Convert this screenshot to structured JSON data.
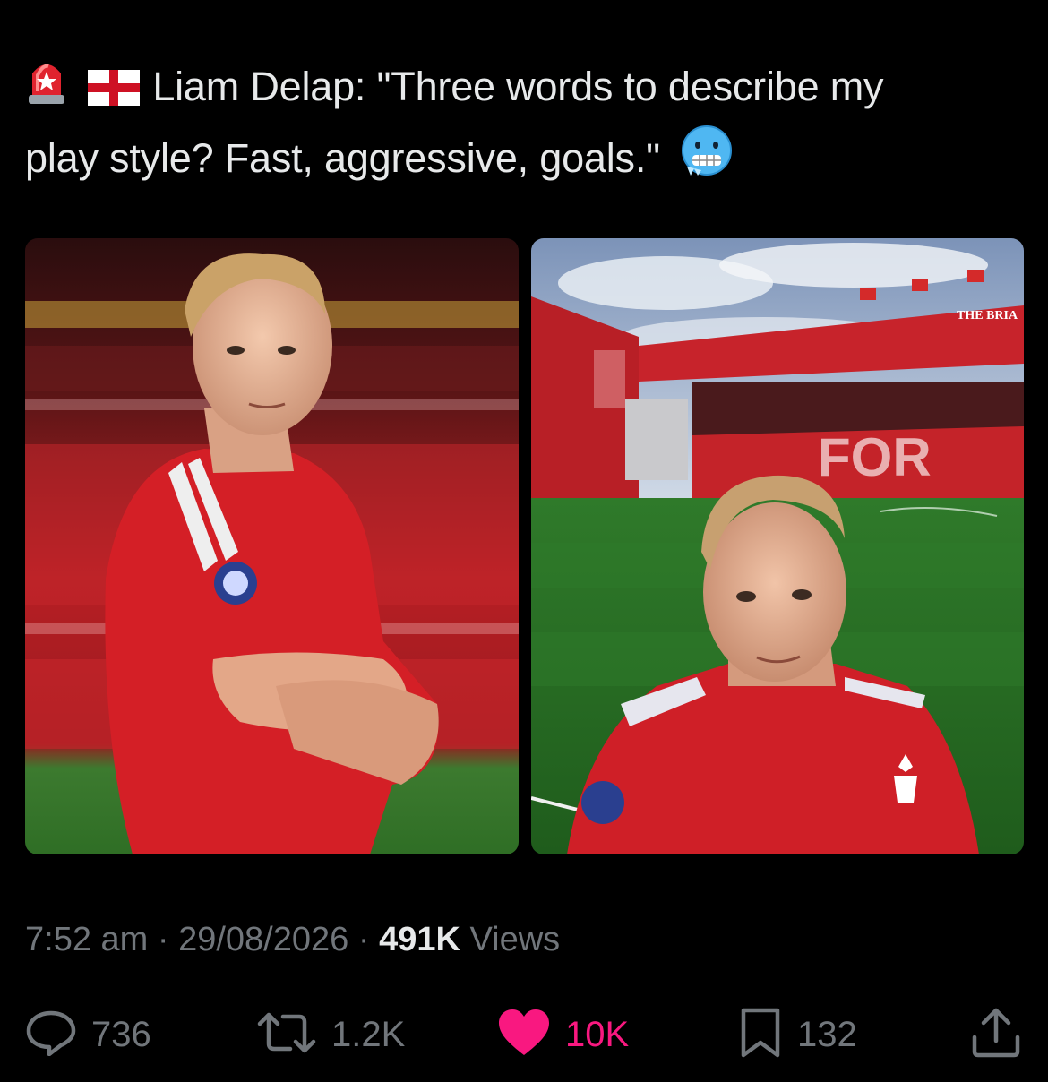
{
  "tweet": {
    "emojis": [
      "rotating-light-emoji",
      "england-flag-emoji"
    ],
    "text_line1": "Liam Delap: \"Three words to describe my",
    "text_line2": "play style? Fast, aggressive, goals.\"",
    "trailing_emoji": "cold-face-emoji"
  },
  "media": [
    {
      "alt": "photo-player-posing-arms-crossed"
    },
    {
      "alt": "photo-player-selfie-stadium",
      "stand_sign": "THE BRIA",
      "seat_letters": "FOR"
    }
  ],
  "meta": {
    "time": "7:52 am",
    "sep1": " · ",
    "date": "29/08/2026",
    "sep2": " · ",
    "views_count": "491K",
    "views_label": " Views"
  },
  "actions": {
    "replies": "736",
    "reposts": "1.2K",
    "likes": "10K",
    "bookmarks": "132"
  },
  "colors": {
    "background": "#000000",
    "text": "#e7e9ea",
    "muted": "#71767b",
    "like": "#f91880"
  }
}
